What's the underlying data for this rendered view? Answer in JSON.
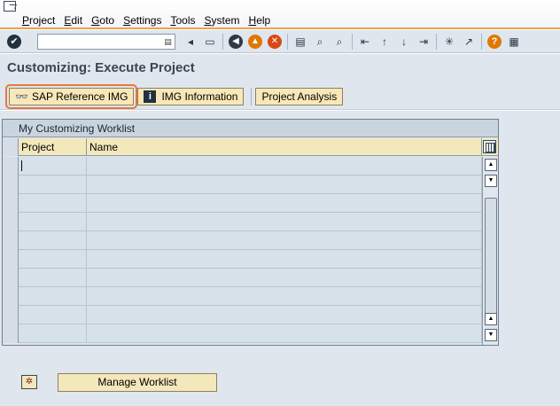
{
  "menu": {
    "items": [
      "Project",
      "Edit",
      "Goto",
      "Settings",
      "Tools",
      "System",
      "Help"
    ]
  },
  "toolbar": {
    "command_field_value": "",
    "icons": [
      "enter-icon",
      "command-dropdown-icon",
      "back-arrow-icon",
      "save-icon",
      "back-icon",
      "exit-icon",
      "cancel-icon",
      "print-icon",
      "find-icon",
      "find-next-icon",
      "first-page-icon",
      "previous-page-icon",
      "next-page-icon",
      "last-page-icon",
      "create-session-icon",
      "shortcut-icon",
      "help-icon",
      "layout-menu-icon"
    ]
  },
  "page": {
    "title": "Customizing: Execute Project"
  },
  "app_toolbar": {
    "sap_reference_img": "SAP Reference IMG",
    "img_information": "IMG Information",
    "project_analysis": "Project Analysis"
  },
  "worklist": {
    "title": "My Customizing Worklist",
    "columns": [
      "Project",
      "Name"
    ],
    "rows": [
      {
        "project": "",
        "name": ""
      },
      {
        "project": "",
        "name": ""
      },
      {
        "project": "",
        "name": ""
      },
      {
        "project": "",
        "name": ""
      },
      {
        "project": "",
        "name": ""
      },
      {
        "project": "",
        "name": ""
      },
      {
        "project": "",
        "name": ""
      },
      {
        "project": "",
        "name": ""
      },
      {
        "project": "",
        "name": ""
      },
      {
        "project": "",
        "name": ""
      }
    ]
  },
  "footer": {
    "manage_worklist": "Manage Worklist"
  },
  "colors": {
    "highlight_outline": "#e8783a",
    "button_yellow": "#f8e8b8",
    "background": "#dfe6ee"
  }
}
